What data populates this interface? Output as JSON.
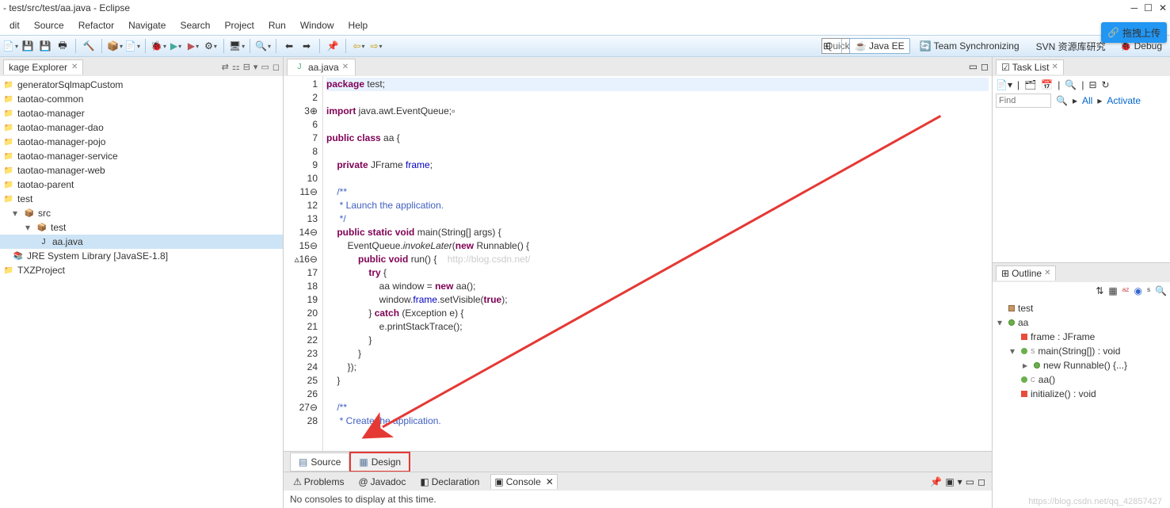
{
  "title": "- test/src/test/aa.java - Eclipse",
  "menu": [
    "dit",
    "Source",
    "Refactor",
    "Navigate",
    "Search",
    "Project",
    "Run",
    "Window",
    "Help"
  ],
  "quick_access": "Quick Access",
  "perspectives": [
    {
      "label": "Java EE",
      "icon": "☕"
    },
    {
      "label": "Team Synchronizing",
      "icon": "🔄"
    },
    {
      "label": "SVN 资源库研究",
      "icon": ""
    },
    {
      "label": "Debug",
      "icon": "🐞"
    }
  ],
  "upload_label": "拖拽上传",
  "explorer": {
    "title": "kage Explorer",
    "items": [
      {
        "label": "generatorSqlmapCustom",
        "icon": "📁",
        "ind": 0
      },
      {
        "label": "taotao-common",
        "icon": "📁",
        "ind": 0
      },
      {
        "label": "taotao-manager",
        "icon": "📁",
        "ind": 0
      },
      {
        "label": "taotao-manager-dao",
        "icon": "📁",
        "ind": 0
      },
      {
        "label": "taotao-manager-pojo",
        "icon": "📁",
        "ind": 0
      },
      {
        "label": "taotao-manager-service",
        "icon": "📁",
        "ind": 0
      },
      {
        "label": "taotao-manager-web",
        "icon": "📁",
        "ind": 0
      },
      {
        "label": "taotao-parent",
        "icon": "📁",
        "ind": 0
      },
      {
        "label": "test",
        "icon": "📁",
        "ind": 0
      },
      {
        "label": "src",
        "icon": "📦",
        "ind": 1,
        "exp": "▾"
      },
      {
        "label": "test",
        "icon": "📦",
        "ind": 2,
        "exp": "▾"
      },
      {
        "label": "aa.java",
        "icon": "J",
        "ind": 3,
        "sel": true
      },
      {
        "label": "JRE System Library [JavaSE-1.8]",
        "icon": "📚",
        "ind": 1
      },
      {
        "label": "TXZProject",
        "icon": "📁",
        "ind": 0
      }
    ]
  },
  "editor": {
    "tab": "aa.java",
    "lines": [
      {
        "n": 1,
        "h": "<span class='kw'>package</span> test;",
        "hl": true
      },
      {
        "n": 2,
        "h": ""
      },
      {
        "n": "3⊕",
        "h": "<span class='kw'>import</span> java.awt.EventQueue;▫"
      },
      {
        "n": 6,
        "h": ""
      },
      {
        "n": 7,
        "h": "<span class='kw'>public class</span> aa {"
      },
      {
        "n": 8,
        "h": ""
      },
      {
        "n": 9,
        "h": "    <span class='kw'>private</span> JFrame <span style='color:#0000c0'>frame</span>;"
      },
      {
        "n": 10,
        "h": ""
      },
      {
        "n": "11⊖",
        "h": "    <span class='jd'>/**</span>"
      },
      {
        "n": 12,
        "h": "<span class='jd'>     * Launch the application.</span>"
      },
      {
        "n": 13,
        "h": "<span class='jd'>     */</span>"
      },
      {
        "n": "14⊖",
        "h": "    <span class='kw'>public static void</span> main(String[] args) {"
      },
      {
        "n": "15⊖",
        "h": "        EventQueue.<span class='mi'>invokeLater</span>(<span class='kw'>new</span> Runnable() {"
      },
      {
        "n": "▵16⊖",
        "h": "            <span class='kw'>public void</span> run() {    <span style='color:#ccc'>http://blog.csdn.net/</span>"
      },
      {
        "n": 17,
        "h": "                <span class='kw'>try</span> {"
      },
      {
        "n": 18,
        "h": "                    aa window = <span class='kw'>new</span> aa();"
      },
      {
        "n": 19,
        "h": "                    window.<span style='color:#0000c0'>frame</span>.setVisible(<span class='kw'>true</span>);"
      },
      {
        "n": 20,
        "h": "                } <span class='kw'>catch</span> (Exception e) {"
      },
      {
        "n": 21,
        "h": "                    e.printStackTrace();"
      },
      {
        "n": 22,
        "h": "                }"
      },
      {
        "n": 23,
        "h": "            }"
      },
      {
        "n": 24,
        "h": "        });"
      },
      {
        "n": 25,
        "h": "    }"
      },
      {
        "n": 26,
        "h": ""
      },
      {
        "n": "27⊖",
        "h": "    <span class='jd'>/**</span>"
      },
      {
        "n": 28,
        "h": "<span class='jd'>     * Create the application.</span>"
      }
    ],
    "bottom_tabs": [
      "Source",
      "Design"
    ]
  },
  "bottom": {
    "tabs": [
      "Problems",
      "Javadoc",
      "Declaration",
      "Console"
    ],
    "msg": "No consoles to display at this time."
  },
  "tasklist": {
    "title": "Task List",
    "find": "Find",
    "all": "All",
    "activate": "Activate"
  },
  "outline": {
    "title": "Outline",
    "items": [
      {
        "label": "test",
        "type": "pkg",
        "ind": 0
      },
      {
        "label": "aa",
        "type": "cls",
        "ind": 0,
        "exp": "▾"
      },
      {
        "label": "frame : JFrame",
        "type": "fld",
        "ind": 1
      },
      {
        "label": "main(String[]) : void",
        "type": "mth",
        "ind": 1,
        "sup": "S",
        "exp": "▾"
      },
      {
        "label": "new Runnable() {...}",
        "type": "cls",
        "ind": 2,
        "exp": "▸"
      },
      {
        "label": "aa()",
        "type": "mth-c",
        "ind": 1,
        "sup": "C"
      },
      {
        "label": "initialize() : void",
        "type": "fld",
        "ind": 1
      }
    ]
  },
  "watermark": "https://blog.csdn.net/qq_42857427"
}
